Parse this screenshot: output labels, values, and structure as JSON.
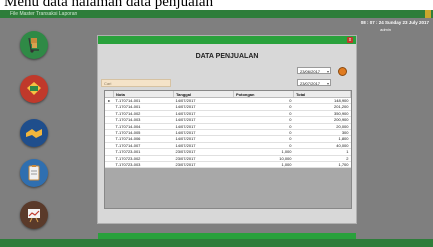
{
  "caption": "Menu data halaman data penjualan",
  "titlebar": {
    "menu_text": "File  Master  Transaksi  Laporan"
  },
  "clock": "08 : 07 : 24  Sunday 23 July 2017",
  "user": "admin",
  "nav": [
    {
      "name": "barang",
      "color": "#2f8a46"
    },
    {
      "name": "penjualan",
      "color": "#2f8a46"
    },
    {
      "name": "transaksi",
      "color": "#2f8a46"
    },
    {
      "name": "laporan",
      "color": "#2f8a46"
    },
    {
      "name": "grafik",
      "color": "#2f8a46"
    }
  ],
  "panel": {
    "title": "DATA PENJUALAN",
    "date_from": "23/06/2017",
    "date_to": "23/07/2017",
    "search_placeholder": "Cari",
    "close": "x"
  },
  "table": {
    "headers": [
      "Nota",
      "Tanggal",
      "Potongan",
      "Total"
    ],
    "rows": [
      [
        "T-170714-001",
        "14/07/2017",
        "0",
        "148,900"
      ],
      [
        "T-170714-001",
        "14/07/2017",
        "0",
        "201,200"
      ],
      [
        "T-170714-002",
        "14/07/2017",
        "0",
        "350,900"
      ],
      [
        "T-170714-003",
        "14/07/2017",
        "0",
        "200,900"
      ],
      [
        "T-170714-004",
        "14/07/2017",
        "0",
        "20,000"
      ],
      [
        "T-170714-005",
        "14/07/2017",
        "0",
        "300"
      ],
      [
        "T-170714-006",
        "14/07/2017",
        "0",
        "1,800"
      ],
      [
        "T-170714-007",
        "14/07/2017",
        "0",
        "40,000"
      ],
      [
        "T-170723-001",
        "23/07/2017",
        "1,000",
        "1"
      ],
      [
        "T-170723-002",
        "23/07/2017",
        "10,000",
        "2"
      ],
      [
        "T-170723-003",
        "23/07/2017",
        "1,000",
        "1,700"
      ]
    ]
  },
  "colors": {
    "accent": "#29a13c",
    "background": "#7f7f7f"
  }
}
